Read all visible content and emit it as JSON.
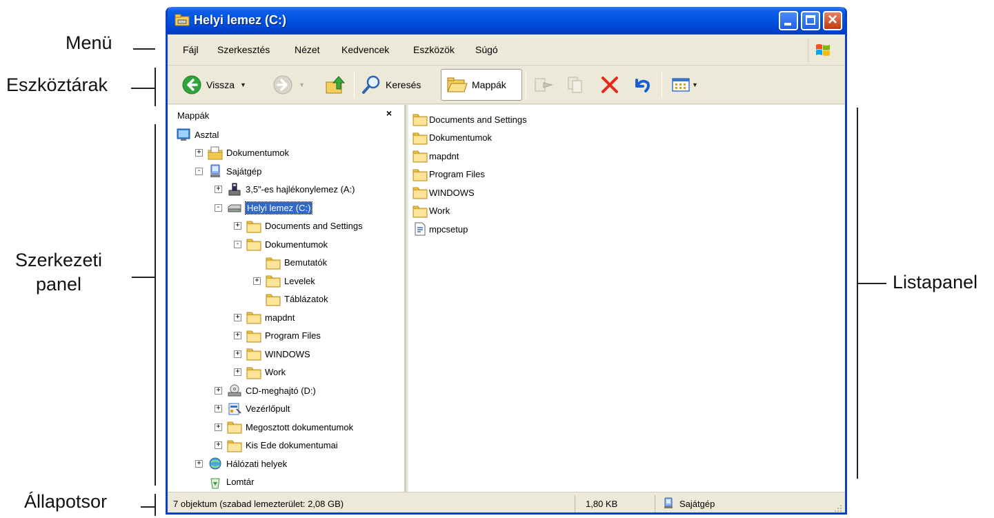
{
  "annotations": {
    "menu": "Menü",
    "toolbars": "Eszköztárak",
    "tree_panel_line1": "Szerkezeti",
    "tree_panel_line2": "panel",
    "list_panel": "Listapanel",
    "status_bar": "Állapotsor"
  },
  "window": {
    "title": "Helyi lemez (C:)"
  },
  "menu": [
    {
      "label": "Fájl",
      "accel": "F"
    },
    {
      "label": "Szerkesztés",
      "accel": "S"
    },
    {
      "label": "Nézet",
      "accel": "N"
    },
    {
      "label": "Kedvencek",
      "accel": "K"
    },
    {
      "label": "Eszközök",
      "accel": "E"
    },
    {
      "label": "Súgó",
      "accel": "g"
    }
  ],
  "toolbar": {
    "back_label": "Vissza",
    "search_label": "Keresés",
    "folders_label": "Mappák"
  },
  "folder_pane": {
    "title": "Mappák",
    "close_glyph": "×",
    "tree": [
      {
        "label": "Asztal",
        "icon": "desktop-icon",
        "indent": 0,
        "toggle": ""
      },
      {
        "label": "Dokumentumok",
        "icon": "my-documents-icon",
        "indent": 1,
        "toggle": "+"
      },
      {
        "label": "Sajátgép",
        "icon": "my-computer-icon",
        "indent": 1,
        "toggle": "−"
      },
      {
        "label": "3,5\"-es hajlékonylemez (A:)",
        "icon": "floppy-drive-icon",
        "indent": 2,
        "toggle": "+"
      },
      {
        "label": "Helyi lemez (C:)",
        "icon": "hard-drive-icon",
        "indent": 2,
        "toggle": "−",
        "selected": true
      },
      {
        "label": "Documents and Settings",
        "icon": "folder-icon",
        "indent": 3,
        "toggle": "+"
      },
      {
        "label": "Dokumentumok",
        "icon": "folder-icon",
        "indent": 3,
        "toggle": "−"
      },
      {
        "label": "Bemutatók",
        "icon": "folder-icon",
        "indent": 4,
        "toggle": ""
      },
      {
        "label": "Levelek",
        "icon": "folder-icon",
        "indent": 4,
        "toggle": "+"
      },
      {
        "label": "Táblázatok",
        "icon": "folder-icon",
        "indent": 4,
        "toggle": ""
      },
      {
        "label": "mapdnt",
        "icon": "folder-icon",
        "indent": 3,
        "toggle": "+"
      },
      {
        "label": "Program Files",
        "icon": "folder-icon",
        "indent": 3,
        "toggle": "+"
      },
      {
        "label": "WINDOWS",
        "icon": "folder-icon",
        "indent": 3,
        "toggle": "+"
      },
      {
        "label": "Work",
        "icon": "folder-icon",
        "indent": 3,
        "toggle": "+"
      },
      {
        "label": "CD-meghajtó (D:)",
        "icon": "cd-drive-icon",
        "indent": 2,
        "toggle": "+"
      },
      {
        "label": "Vezérlőpult",
        "icon": "control-panel-icon",
        "indent": 2,
        "toggle": "+"
      },
      {
        "label": "Megosztott dokumentumok",
        "icon": "folder-icon",
        "indent": 2,
        "toggle": "+"
      },
      {
        "label": "Kis Ede dokumentumai",
        "icon": "folder-icon",
        "indent": 2,
        "toggle": "+"
      },
      {
        "label": "Hálózati helyek",
        "icon": "network-places-icon",
        "indent": 1,
        "toggle": "+"
      },
      {
        "label": "Lomtár",
        "icon": "recycle-bin-icon",
        "indent": 1,
        "toggle": ""
      }
    ]
  },
  "list_pane": {
    "items": [
      {
        "label": "Documents and Settings",
        "icon": "folder-icon"
      },
      {
        "label": "Dokumentumok",
        "icon": "folder-icon"
      },
      {
        "label": "mapdnt",
        "icon": "folder-icon"
      },
      {
        "label": "Program Files",
        "icon": "folder-icon"
      },
      {
        "label": "WINDOWS",
        "icon": "folder-icon"
      },
      {
        "label": "Work",
        "icon": "folder-icon"
      },
      {
        "label": "mpcsetup",
        "icon": "file-icon"
      }
    ]
  },
  "status_bar": {
    "objects": "7 objektum  (szabad lemezterület: 2,08 GB)",
    "size": "1,80 KB",
    "location": "Sajátgép"
  },
  "colors": {
    "title_bar": "#0053e0",
    "selection": "#316ac5",
    "chrome": "#ece9d8",
    "close_button": "#c2380f"
  }
}
